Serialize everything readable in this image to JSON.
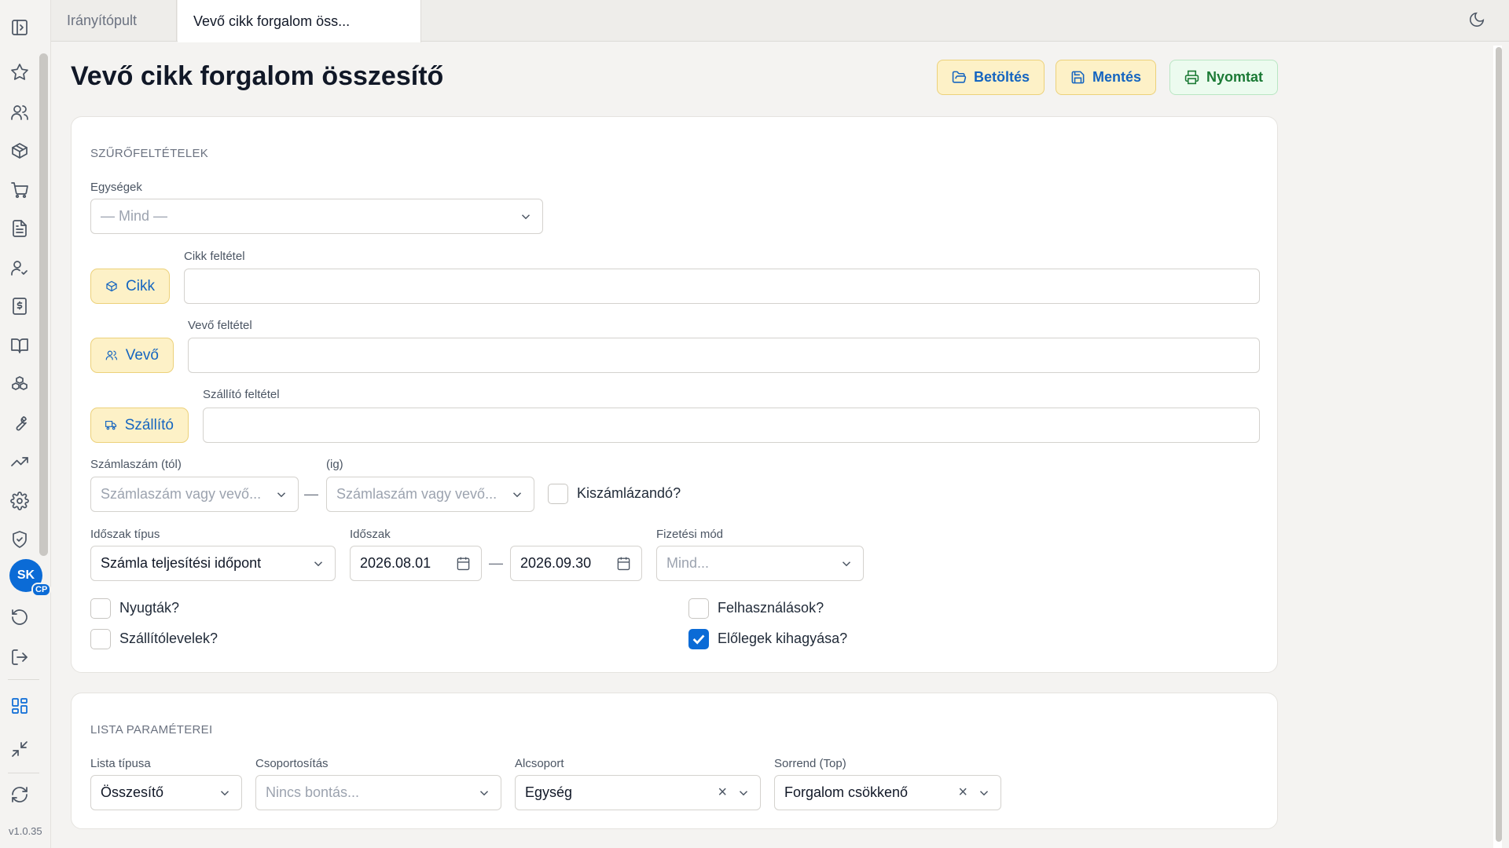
{
  "sidebar": {
    "version": "v1.0.35",
    "avatar_initials": "SK",
    "avatar_badge": "CP",
    "icons": [
      "sidebar-toggle-icon",
      "star-icon",
      "users-icon",
      "package-icon",
      "cart-icon",
      "document-icon",
      "user-check-icon",
      "invoice-icon",
      "book-icon",
      "boxes-icon",
      "wrench-icon",
      "trending-up-icon",
      "settings-icon",
      "shield-check-icon",
      "undo-icon",
      "logout-icon",
      "layout-grid-icon",
      "minimize-icon",
      "refresh-icon"
    ]
  },
  "tabs": [
    {
      "label": "Irányítópult",
      "active": false
    },
    {
      "label": "Vevő cikk forgalom öss...",
      "active": true
    }
  ],
  "header": {
    "title": "Vevő cikk forgalom összesítő",
    "load_label": "Betöltés",
    "save_label": "Mentés",
    "print_label": "Nyomtat"
  },
  "filters": {
    "section_title": "SZŰRŐFELTÉTELEK",
    "units_label": "Egységek",
    "units_placeholder": "— Mind —",
    "item_button": "Cikk",
    "item_condition_label": "Cikk feltétel",
    "item_condition_value": "",
    "customer_button": "Vevő",
    "customer_condition_label": "Vevő feltétel",
    "customer_condition_value": "",
    "supplier_button": "Szállító",
    "supplier_condition_label": "Szállító feltétel",
    "supplier_condition_value": "",
    "invoice_from_label": "Számlaszám (tól)",
    "invoice_from_placeholder": "Számlaszám vagy vevő...",
    "invoice_to_label": "(ig)",
    "invoice_to_placeholder": "Számlaszám vagy vevő...",
    "range_dash": "—",
    "to_invoice_label": "Kiszámlázandó?",
    "to_invoice_checked": false,
    "period_type_label": "Időszak típus",
    "period_type_value": "Számla teljesítési időpont",
    "period_label": "Időszak",
    "period_from": "2026.08.01",
    "period_to": "2026.09.30",
    "payment_label": "Fizetési mód",
    "payment_placeholder": "Mind...",
    "receipts_label": "Nyugták?",
    "receipts_checked": false,
    "delivery_notes_label": "Szállítólevelek?",
    "delivery_notes_checked": false,
    "usages_label": "Felhasználások?",
    "usages_checked": false,
    "skip_advances_label": "Előlegek kihagyása?",
    "skip_advances_checked": true
  },
  "list_params": {
    "section_title": "LISTA PARAMÉTEREI",
    "list_type_label": "Lista típusa",
    "list_type_value": "Összesítő",
    "grouping_label": "Csoportosítás",
    "grouping_placeholder": "Nincs bontás...",
    "subgroup_label": "Alcsoport",
    "subgroup_value": "Egység",
    "order_label": "Sorrend (Top)",
    "order_value": "Forgalom csökkenő"
  },
  "colors": {
    "accent": "#0b6bd6",
    "warning_bg": "#fdf1c7",
    "success_text": "#1b7a35"
  }
}
